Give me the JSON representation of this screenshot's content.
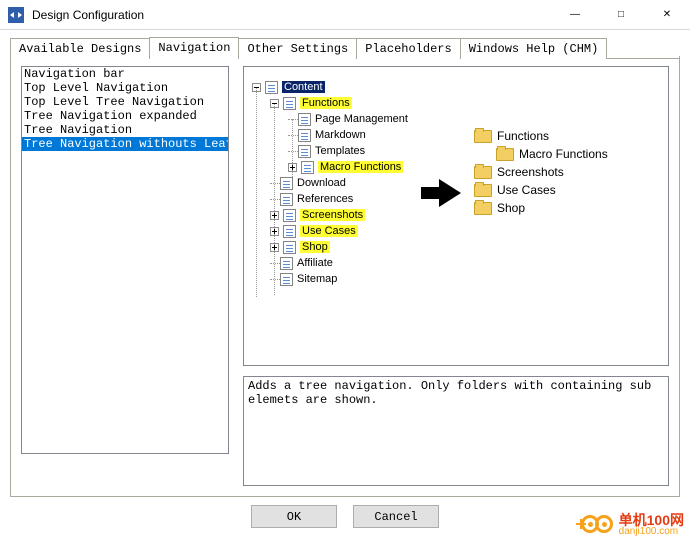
{
  "window": {
    "title": "Design Configuration"
  },
  "tabs": [
    {
      "label": "Available Designs"
    },
    {
      "label": "Navigation"
    },
    {
      "label": "Other Settings"
    },
    {
      "label": "Placeholders"
    },
    {
      "label": "Windows Help (CHM)"
    }
  ],
  "active_tab": 1,
  "nav_options": [
    "Navigation bar",
    "Top Level Navigation",
    "Top Level Tree Navigation",
    "Tree Navigation expanded",
    "Tree Navigation",
    "Tree Navigation withouts Leafs"
  ],
  "nav_selected": 5,
  "preview_tree": {
    "root": "Content",
    "children": [
      {
        "label": "Functions",
        "hl": true,
        "expanded": true,
        "children": [
          {
            "label": "Page Management"
          },
          {
            "label": "Markdown"
          },
          {
            "label": "Templates"
          },
          {
            "label": "Macro Functions",
            "hl": true,
            "expandable": true
          }
        ]
      },
      {
        "label": "Download"
      },
      {
        "label": "References"
      },
      {
        "label": "Screenshots",
        "hl": true,
        "expandable": true
      },
      {
        "label": "Use Cases",
        "hl": true,
        "expandable": true
      },
      {
        "label": "Shop",
        "hl": true,
        "expandable": true
      },
      {
        "label": "Affiliate"
      },
      {
        "label": "Sitemap"
      }
    ]
  },
  "preview_right": [
    {
      "label": "Functions",
      "indent": 0
    },
    {
      "label": "Macro Functions",
      "indent": 1
    },
    {
      "label": "Screenshots",
      "indent": 0
    },
    {
      "label": "Use Cases",
      "indent": 0
    },
    {
      "label": "Shop",
      "indent": 0
    }
  ],
  "description": "Adds a tree navigation. Only folders with containing sub elemets are shown.",
  "buttons": {
    "ok": "OK",
    "cancel": "Cancel"
  },
  "watermark": {
    "line1": "单机100网",
    "line2": "danji100.com"
  }
}
